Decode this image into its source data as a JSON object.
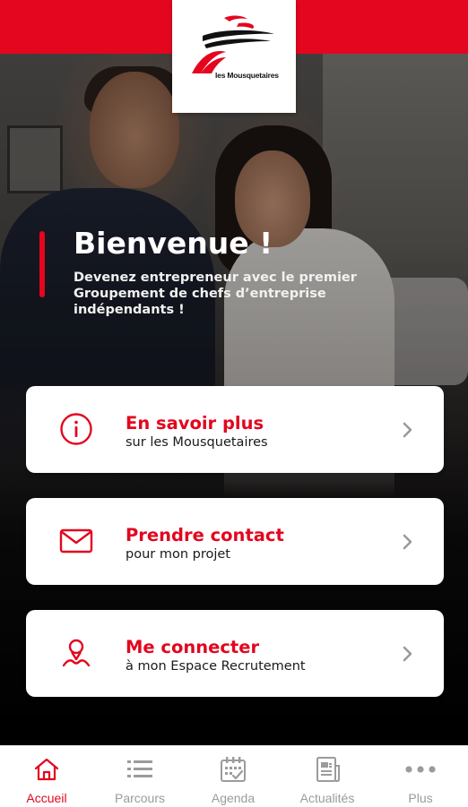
{
  "brand": {
    "name": "les Mousquetaires",
    "color": "#e3061e"
  },
  "welcome": {
    "title": "Bienvenue !",
    "subtitle": "Devenez entrepreneur avec le premier Groupement de chefs d’entreprise indépendants !"
  },
  "cards": [
    {
      "title": "En savoir plus",
      "subtitle": "sur les Mousquetaires",
      "icon": "info-icon"
    },
    {
      "title": "Prendre contact",
      "subtitle": "pour mon projet",
      "icon": "mail-icon"
    },
    {
      "title": "Me connecter",
      "subtitle": "à mon Espace Recrutement",
      "icon": "user-location-icon"
    }
  ],
  "tabs": [
    {
      "label": "Accueil",
      "icon": "home-icon",
      "active": true
    },
    {
      "label": "Parcours",
      "icon": "list-icon",
      "active": false
    },
    {
      "label": "Agenda",
      "icon": "calendar-icon",
      "active": false
    },
    {
      "label": "Actualités",
      "icon": "news-icon",
      "active": false
    },
    {
      "label": "Plus",
      "icon": "more-icon",
      "active": false
    }
  ]
}
